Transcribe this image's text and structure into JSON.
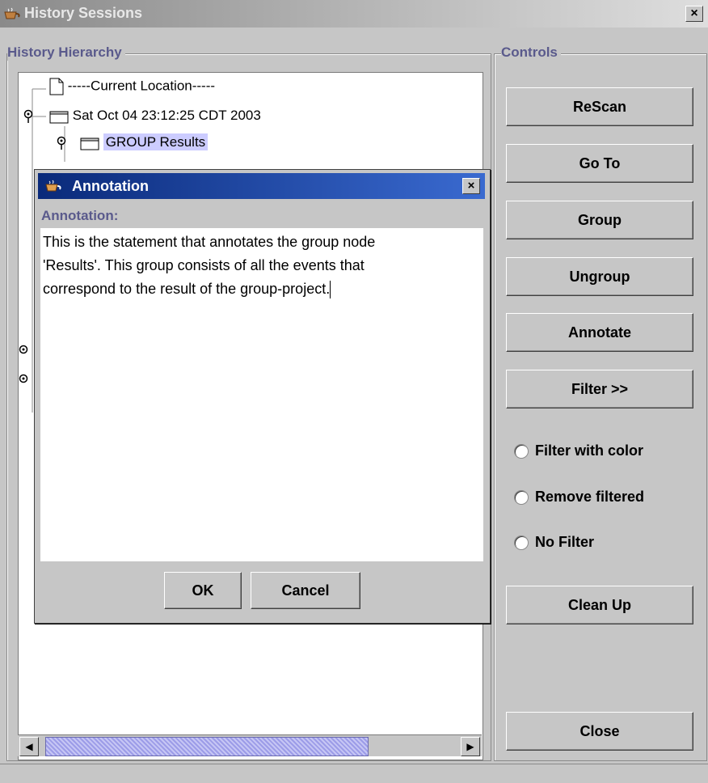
{
  "window": {
    "title": "History Sessions",
    "close_label": "×"
  },
  "hierarchy": {
    "legend": "History Hierarchy",
    "rows": [
      {
        "label": "-----Current Location-----"
      },
      {
        "label": "Sat Oct 04 23:12:25 CDT 2003"
      },
      {
        "label": "GROUP Results"
      }
    ]
  },
  "scrollbar": {
    "left_arrow": "◀",
    "right_arrow": "▶"
  },
  "controls": {
    "legend": "Controls",
    "buttons": [
      "ReScan",
      "Go To",
      "Group",
      "Ungroup",
      "Annotate",
      "Filter >>",
      "Clean Up",
      "Close"
    ],
    "filters": [
      "Filter with color",
      "Remove filtered",
      "No Filter"
    ]
  },
  "dialog": {
    "title": "Annotation",
    "close_label": "×",
    "field_label": "Annotation:",
    "text_lines": [
      "This is the statement that annotates the group node",
      "'Results'. This group consists of all the events that",
      "correspond to the result of the group-project."
    ],
    "ok_label": "OK",
    "cancel_label": "Cancel"
  }
}
